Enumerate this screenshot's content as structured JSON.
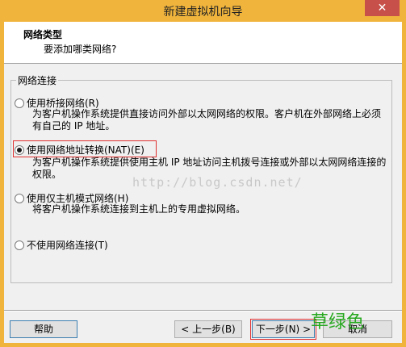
{
  "window": {
    "title": "新建虚拟机向导",
    "close_glyph": "✕"
  },
  "header": {
    "title": "网络类型",
    "subtitle": "要添加哪类网络?"
  },
  "group": {
    "label": "网络连接"
  },
  "options": [
    {
      "label": "使用桥接网络(R)",
      "selected": false,
      "description": [
        "为客户机操作系统提供直接访问外部以太网网络的权限。客户机在外部网络上必须",
        "有自己的 IP 地址。"
      ]
    },
    {
      "label": "使用网络地址转换(NAT)(E)",
      "selected": true,
      "description": [
        "为客户机操作系统提供使用主机 IP 地址访问主机拨号连接或外部以太网网络连接的",
        "权限。"
      ]
    },
    {
      "label": "使用仅主机模式网络(H)",
      "selected": false,
      "description": [
        "将客户机操作系统连接到主机上的专用虚拟网络。"
      ]
    },
    {
      "label": "不使用网络连接(T)",
      "selected": false,
      "description": []
    }
  ],
  "watermark": "http://blog.csdn.net/",
  "buttons": {
    "help": "帮助",
    "back": "< 上一步(B)",
    "next": "下一步(N) >",
    "cancel": "取消"
  },
  "stamp": "草绿色",
  "colors": {
    "titlebar": "#f0b43c",
    "close_button": "#c7504a",
    "highlight_frame": "#e03030",
    "stamp": "#27a81f"
  }
}
